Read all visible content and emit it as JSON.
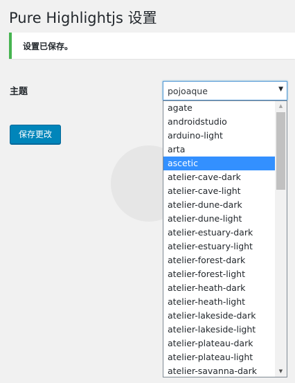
{
  "page": {
    "title": "Pure Highlightjs 设置"
  },
  "notice": {
    "text": "设置已保存。"
  },
  "form": {
    "theme_label": "主题",
    "theme_selected": "pojoaque",
    "save_label": "保存更改"
  },
  "icons": {
    "select_arrow": "chevron-down-icon",
    "scroll_up": "scroll-up-arrow-icon",
    "scroll_down": "scroll-down-arrow-icon"
  },
  "colors": {
    "notice_border": "#46b450",
    "primary_button": "#0085ba",
    "option_highlight": "#3390ff"
  },
  "dropdown": {
    "highlighted_index": 4,
    "options": [
      "agate",
      "androidstudio",
      "arduino-light",
      "arta",
      "ascetic",
      "atelier-cave-dark",
      "atelier-cave-light",
      "atelier-dune-dark",
      "atelier-dune-light",
      "atelier-estuary-dark",
      "atelier-estuary-light",
      "atelier-forest-dark",
      "atelier-forest-light",
      "atelier-heath-dark",
      "atelier-heath-light",
      "atelier-lakeside-dark",
      "atelier-lakeside-light",
      "atelier-plateau-dark",
      "atelier-plateau-light",
      "atelier-savanna-dark"
    ]
  }
}
